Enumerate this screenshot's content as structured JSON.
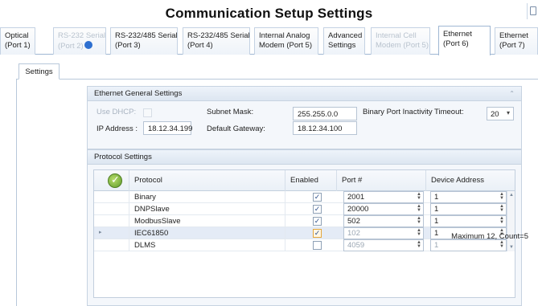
{
  "window": {
    "title": "Communication Setup Settings"
  },
  "tabs": [
    {
      "line1": "Optical",
      "line2": "(Port 1)",
      "state": "normal"
    },
    {
      "line1": "RS-232 Serial",
      "line2": "(Port 2)",
      "state": "disabled"
    },
    {
      "line1": "RS-232/485 Serial",
      "line2": "(Port 3)",
      "state": "normal"
    },
    {
      "line1": "RS-232/485 Serial",
      "line2": "(Port 4)",
      "state": "normal"
    },
    {
      "line1": "Internal Analog",
      "line2": "Modem (Port 5)",
      "state": "normal"
    },
    {
      "line1": "Advanced",
      "line2": "Settings",
      "state": "normal"
    },
    {
      "line1": "Internal Cell",
      "line2": "Modem (Port 5)",
      "state": "disabled"
    },
    {
      "line1": "Ethernet",
      "line2": "(Port 6)",
      "state": "active"
    },
    {
      "line1": "Ethernet",
      "line2": "(Port 7)",
      "state": "normal"
    }
  ],
  "subtab": {
    "label": "Settings"
  },
  "ethernet_general": {
    "header": "Ethernet General Settings",
    "use_dhcp_label": "Use DHCP:",
    "use_dhcp_checked": false,
    "ip_label": "IP Address :",
    "ip_value": "18.12.34.199",
    "subnet_label": "Subnet Mask:",
    "subnet_value": "255.255.0.0",
    "gateway_label": "Default Gateway:",
    "gateway_value": "18.12.34.100",
    "timeout_label": "Binary Port Inactivity Timeout:",
    "timeout_value": "20"
  },
  "protocol_settings": {
    "header": "Protocol Settings",
    "columns": {
      "protocol": "Protocol",
      "enabled": "Enabled",
      "port": "Port #",
      "device": "Device Address"
    },
    "rows": [
      {
        "protocol": "Binary",
        "enabled": true,
        "port": "2001",
        "device": "1",
        "editable": true,
        "selected": false
      },
      {
        "protocol": "DNPSlave",
        "enabled": true,
        "port": "20000",
        "device": "1",
        "editable": true,
        "selected": false
      },
      {
        "protocol": "ModbusSlave",
        "enabled": true,
        "port": "502",
        "device": "1",
        "editable": true,
        "selected": false
      },
      {
        "protocol": "IEC61850",
        "enabled": true,
        "port": "102",
        "device": "1",
        "editable": false,
        "selected": true
      },
      {
        "protocol": "DLMS",
        "enabled": false,
        "port": "4059",
        "device": "1",
        "editable": false,
        "selected": false
      }
    ],
    "footer": "Maximum 12, Count=5"
  },
  "icons": {
    "check_glyph": "✓",
    "selected_row_indicator": "▸"
  },
  "colors": {
    "tab_border": "#9fb7d3",
    "group_bg": "#f4f7fb",
    "selected_row": "#e4ebf6",
    "logo_green": "#5e9a2a"
  }
}
